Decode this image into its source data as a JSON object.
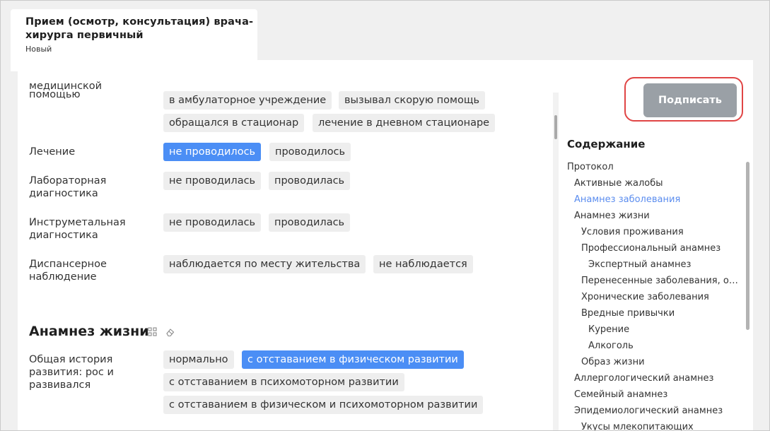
{
  "document": {
    "title_line1": "Прием (осмотр, консультация) врача-",
    "title_line2": "хирурга первичный",
    "status": "Новый"
  },
  "form": {
    "rows": [
      {
        "label_line1": "медицинской",
        "label_line2": "помощью",
        "options": [
          "в амбулаторное учреждение",
          "вызывал скорую помощь",
          "обращался в стационар",
          "лечение в дневном стационаре"
        ]
      },
      {
        "label_line1": "Лечение",
        "options": [
          "не проводилось",
          "проводилось"
        ],
        "selected": "не проводилось"
      },
      {
        "label_line1": "Лабораторная",
        "label_line2": "диагностика",
        "options": [
          "не проводилась",
          "проводилась"
        ]
      },
      {
        "label_line1": "Инструметальная",
        "label_line2": "диагностика",
        "options": [
          "не проводилась",
          "проводилась"
        ]
      },
      {
        "label_line1": "Диспансерное",
        "label_line2": "наблюдение",
        "options": [
          "наблюдается по месту жительства",
          "не наблюдается"
        ]
      }
    ],
    "section": {
      "title": "Анамнез жизни",
      "row": {
        "label_line1": "Общая история",
        "label_line2": "развития: рос и",
        "label_line3": "развивался",
        "options": [
          "нормально",
          "с отставанием в физическом развитии",
          "с отставанием в психомоторном развитии",
          "с отставанием в физическом и психомоторном развитии"
        ],
        "selected": "с отставанием в физическом развитии"
      }
    }
  },
  "sign_button": "Подписать",
  "toc": {
    "title": "Содержание",
    "items": [
      {
        "label": "Протокол",
        "level": 0
      },
      {
        "label": "Активные жалобы",
        "level": 1
      },
      {
        "label": "Анамнез заболевания",
        "level": 1,
        "active": true
      },
      {
        "label": "Анамнез жизни",
        "level": 1
      },
      {
        "label": "Условия проживания",
        "level": 2
      },
      {
        "label": "Профессиональный анамнез",
        "level": 2
      },
      {
        "label": "Экспертный анамнез",
        "level": 3
      },
      {
        "label": "Перенесенные заболевания, опе...",
        "level": 2
      },
      {
        "label": "Хронические заболевания",
        "level": 2
      },
      {
        "label": "Вредные привычки",
        "level": 2
      },
      {
        "label": "Курение",
        "level": 3
      },
      {
        "label": "Алкоголь",
        "level": 3
      },
      {
        "label": "Образ жизни",
        "level": 2
      },
      {
        "label": "Аллергологический анамнез",
        "level": 1
      },
      {
        "label": "Семейный анамнез",
        "level": 1
      },
      {
        "label": "Эпидемиологический анамнез",
        "level": 1
      },
      {
        "label": "Укусы млекопитающих",
        "level": 2
      }
    ]
  },
  "icons": {
    "section_grid": "grid-icon",
    "section_eraser": "eraser-icon"
  },
  "colors": {
    "selected_chip": "#4b8ef5",
    "toc_active": "#5b8def",
    "highlight_ring": "#e04545",
    "sign_button": "#9aa0a6"
  }
}
